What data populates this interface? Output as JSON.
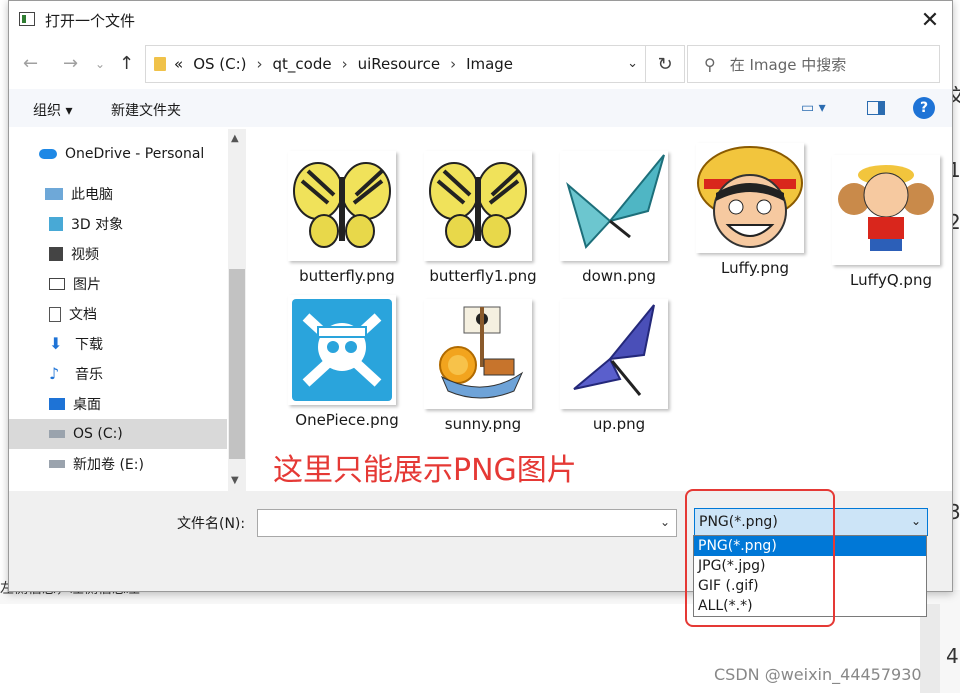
{
  "window": {
    "title": "打开一个文件",
    "close_glyph": "✕"
  },
  "address": {
    "overflow": "«",
    "segments": [
      "OS (C:)",
      "qt_code",
      "uiResource",
      "Image"
    ]
  },
  "search": {
    "placeholder": "在 Image 中搜索"
  },
  "toolbar": {
    "organize": "组织 ▾",
    "new_folder": "新建文件夹",
    "view": "▭ ▾",
    "help": "?"
  },
  "sidebar": {
    "items": [
      {
        "label": "OneDrive - Personal",
        "icon": "cloud-icon"
      },
      {
        "label": "此电脑",
        "icon": "computer-icon"
      },
      {
        "label": "3D 对象",
        "icon": "3d-objects-icon"
      },
      {
        "label": "视频",
        "icon": "video-icon"
      },
      {
        "label": "图片",
        "icon": "pictures-icon"
      },
      {
        "label": "文档",
        "icon": "documents-icon"
      },
      {
        "label": "下载",
        "icon": "download-icon"
      },
      {
        "label": "音乐",
        "icon": "music-icon"
      },
      {
        "label": "桌面",
        "icon": "desktop-icon"
      },
      {
        "label": "OS (C:)",
        "icon": "drive-icon",
        "selected": true
      },
      {
        "label": "新加卷 (E:)",
        "icon": "drive-icon"
      }
    ]
  },
  "files": [
    {
      "name": "butterfly.png",
      "icon": "yellow-butterfly-icon"
    },
    {
      "name": "butterfly1.png",
      "icon": "yellow-butterfly-icon"
    },
    {
      "name": "down.png",
      "icon": "teal-butterfly-icon"
    },
    {
      "name": "Luffy.png",
      "icon": "luffy-face-icon"
    },
    {
      "name": "LuffyQ.png",
      "icon": "luffy-chibi-icon"
    },
    {
      "name": "OnePiece.png",
      "icon": "jolly-roger-icon"
    },
    {
      "name": "sunny.png",
      "icon": "ship-icon"
    },
    {
      "name": "up.png",
      "icon": "blue-butterfly-icon"
    }
  ],
  "annotation": "这里只能展示PNG图片",
  "footer": {
    "filename_label": "文件名(N):",
    "filename_value": "",
    "filter_value": "PNG(*.png)"
  },
  "filter_options": [
    "PNG(*.png)",
    "JPG(*.jpg)",
    "GIF (.gif)",
    "ALL(*.*)"
  ],
  "background": {
    "behind_text": "左侧信息，左侧信息左",
    "watermark": "CSDN @weixin_44457930"
  }
}
